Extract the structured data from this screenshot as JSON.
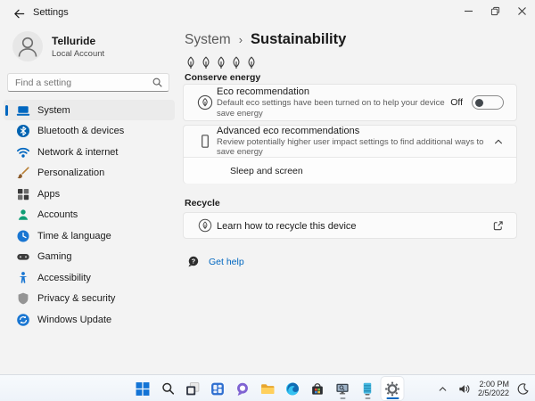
{
  "window": {
    "title": "Settings"
  },
  "account": {
    "name": "Telluride",
    "type": "Local Account"
  },
  "search": {
    "placeholder": "Find a setting"
  },
  "sidebar": {
    "items": [
      {
        "label": "System",
        "icon": "system-icon",
        "selected": true
      },
      {
        "label": "Bluetooth & devices",
        "icon": "bluetooth-icon",
        "selected": false
      },
      {
        "label": "Network & internet",
        "icon": "network-icon",
        "selected": false
      },
      {
        "label": "Personalization",
        "icon": "personalization-icon",
        "selected": false
      },
      {
        "label": "Apps",
        "icon": "apps-icon",
        "selected": false
      },
      {
        "label": "Accounts",
        "icon": "accounts-icon",
        "selected": false
      },
      {
        "label": "Time & language",
        "icon": "time-language-icon",
        "selected": false
      },
      {
        "label": "Gaming",
        "icon": "gaming-icon",
        "selected": false
      },
      {
        "label": "Accessibility",
        "icon": "accessibility-icon",
        "selected": false
      },
      {
        "label": "Privacy & security",
        "icon": "privacy-icon",
        "selected": false
      },
      {
        "label": "Windows Update",
        "icon": "windows-update-icon",
        "selected": false
      }
    ]
  },
  "main": {
    "breadcrumb": {
      "parent": "System",
      "separator": "›",
      "current": "Sustainability"
    },
    "conserve": {
      "label": "Conserve energy",
      "leaf_count": 5
    },
    "eco_card": {
      "title": "Eco recommendation",
      "description": "Default eco settings have been turned on to help your device save energy",
      "toggle_label": "Off",
      "toggle_state": "off"
    },
    "advanced_card": {
      "title": "Advanced eco recommendations",
      "description": "Review potentially higher user impact settings to find additional ways to save energy",
      "expanded": true,
      "sub_item": "Sleep and screen"
    },
    "recycle": {
      "label": "Recycle",
      "link_title": "Learn how to recycle this device"
    },
    "help": {
      "label": "Get help"
    }
  },
  "taskbar": {
    "icons": [
      "start",
      "search",
      "task-view",
      "widgets",
      "chat",
      "file-explorer",
      "edge",
      "store",
      "monitor-tool",
      "server",
      "settings"
    ],
    "active_icon": "settings",
    "tray": {
      "time": "2:00 PM",
      "date": "2/5/2022"
    }
  },
  "colors": {
    "accent": "#0067c0",
    "background": "#f3f3f3",
    "card": "#fbfbfb",
    "taskbar": "#eef3f9"
  }
}
